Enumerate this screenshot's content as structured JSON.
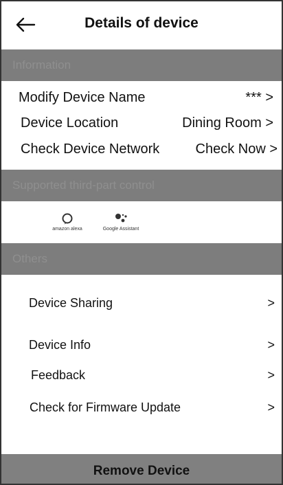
{
  "header": {
    "title": "Details of device",
    "back_icon": "arrow-left-icon"
  },
  "sections": {
    "information": "Information",
    "third_party": "Supported third-part control",
    "others": "Others"
  },
  "info_rows": [
    {
      "label": "Modify Device Name",
      "value": "*** >"
    },
    {
      "label": "Device Location",
      "value": "Dining Room >"
    },
    {
      "label": "Check Device Network",
      "value": "Check Now >"
    }
  ],
  "assistants": [
    {
      "label": "amazon alexa",
      "icon": "alexa-ring-icon"
    },
    {
      "label": "Google Assistant",
      "icon": "google-assistant-icon"
    }
  ],
  "others_rows": [
    {
      "label": "Device Sharing",
      "chevron": ">"
    },
    {
      "label": "Device Info",
      "chevron": ">"
    },
    {
      "label": "Feedback",
      "chevron": ">"
    },
    {
      "label": "Check for Firmware Update",
      "chevron": ">"
    }
  ],
  "footer": {
    "remove_label": "Remove Device"
  },
  "colors": {
    "section_bg": "#7d7d7d",
    "section_text": "#8f8f8f",
    "footer_bg": "#808080",
    "border": "#333333"
  }
}
